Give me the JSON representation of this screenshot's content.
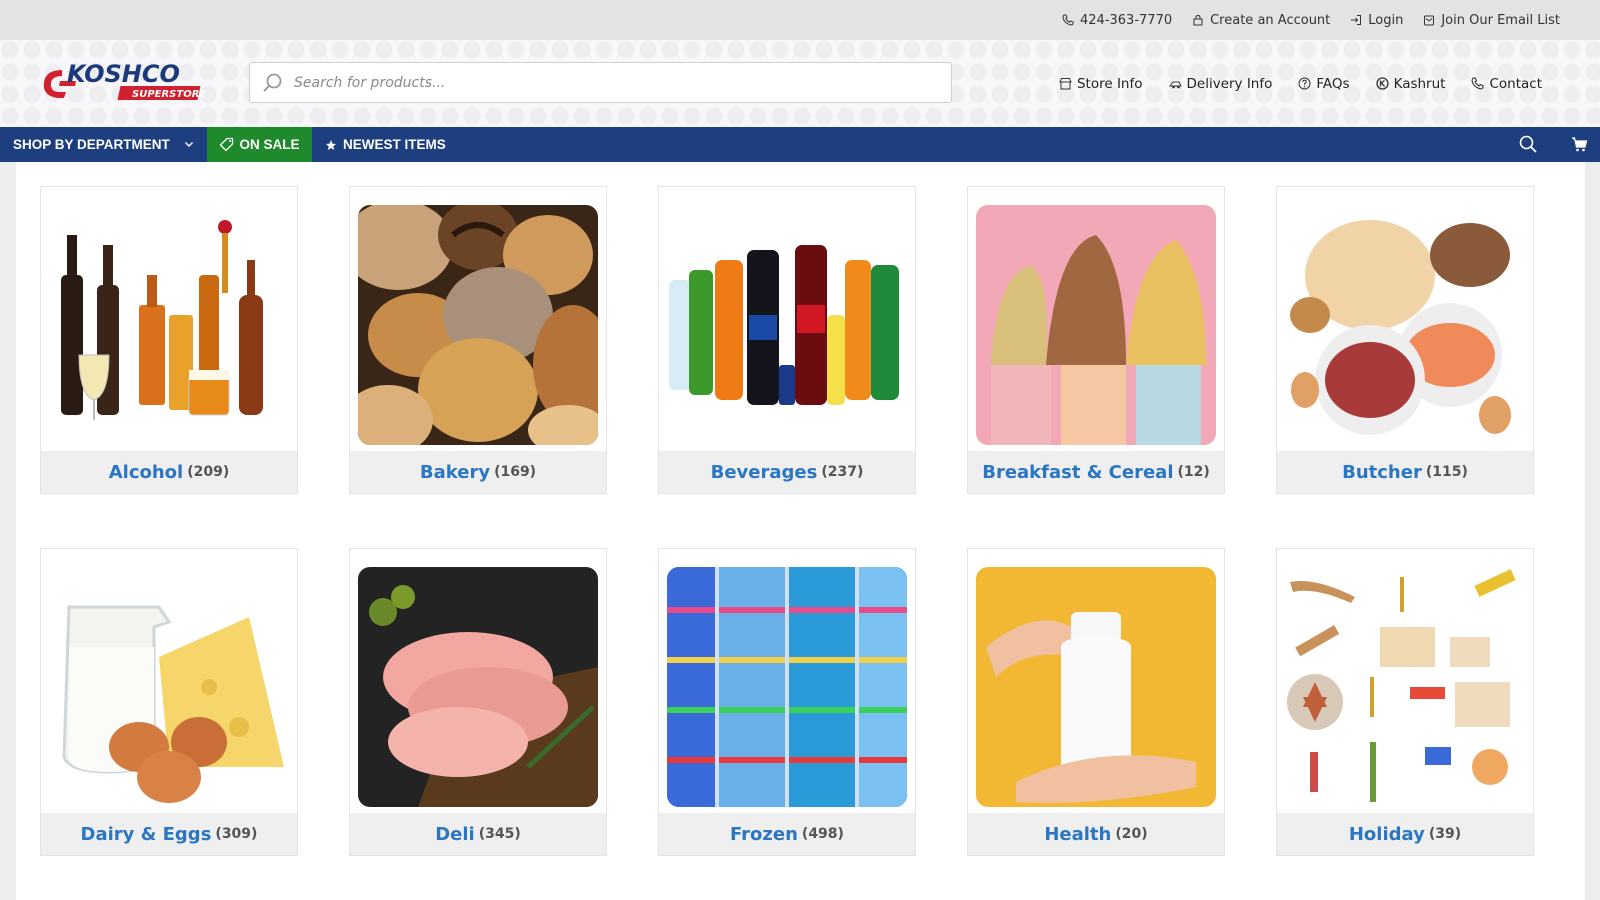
{
  "topbar": {
    "phone": "424-363-7770",
    "create_account": "Create an Account",
    "login": "Login",
    "email_list": "Join Our Email List"
  },
  "header": {
    "logo": {
      "main": "KOSHCO",
      "sub": "SUPERSTORE"
    },
    "search_placeholder": "Search for products...",
    "nav": {
      "store_info": "Store Info",
      "delivery_info": "Delivery Info",
      "faqs": "FAQs",
      "kashrut": "Kashrut",
      "contact": "Contact"
    }
  },
  "navbar": {
    "department": "SHOP BY DEPARTMENT",
    "on_sale": "ON SALE",
    "newest": "NEWEST ITEMS"
  },
  "categories": [
    {
      "name": "Alcohol",
      "count": "(209)",
      "icon": "alcohol-bottles"
    },
    {
      "name": "Bakery",
      "count": "(169)",
      "icon": "bread"
    },
    {
      "name": "Beverages",
      "count": "(237)",
      "icon": "soda-bottles"
    },
    {
      "name": "Breakfast & Cereal",
      "count": "(12)",
      "icon": "cereal"
    },
    {
      "name": "Butcher",
      "count": "(115)",
      "icon": "meat-poultry"
    },
    {
      "name": "Dairy & Eggs",
      "count": "(309)",
      "icon": "milk-cheese-eggs"
    },
    {
      "name": "Deli",
      "count": "(345)",
      "icon": "sliced-meat"
    },
    {
      "name": "Frozen",
      "count": "(498)",
      "icon": "freezer-aisle"
    },
    {
      "name": "Health",
      "count": "(20)",
      "icon": "supplement-bottle"
    },
    {
      "name": "Holiday",
      "count": "(39)",
      "icon": "holiday-items"
    }
  ],
  "colors": {
    "nav_blue": "#1e3f7f",
    "sale_green": "#1e8a2c",
    "category_blue": "#2a76c2",
    "logo_red": "#d1202f",
    "logo_navy": "#1c3a7a"
  }
}
